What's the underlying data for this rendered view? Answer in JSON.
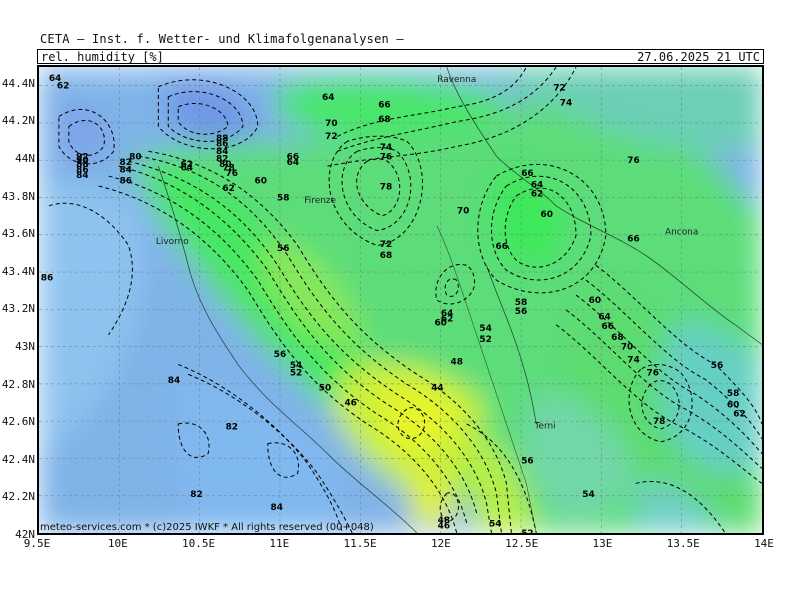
{
  "header": {
    "title": "CETA – Inst. f. Wetter- und Klimafolgenanalysen –",
    "variable": "rel. humidity [%]",
    "datetime": "27.06.2025 21 UTC"
  },
  "footer": "meteo-services.com * (c)2025 IWKF * All rights reserved (00+048)",
  "axes": {
    "y_ticks": [
      "44.4N",
      "44.2N",
      "44N",
      "43.8N",
      "43.6N",
      "43.4N",
      "43.2N",
      "43N",
      "42.8N",
      "42.6N",
      "42.4N",
      "42.2N",
      "42N"
    ],
    "x_ticks": [
      "9.5E",
      "10E",
      "10.5E",
      "11E",
      "11.5E",
      "12E",
      "12.5E",
      "13E",
      "13.5E",
      "14E"
    ],
    "lat_range": [
      42.0,
      44.5
    ],
    "lon_range": [
      9.5,
      14.0
    ],
    "grid": true
  },
  "cities": [
    {
      "name": "Ravenna",
      "lon": 12.1,
      "lat": 44.42
    },
    {
      "name": "Firenze",
      "lon": 11.25,
      "lat": 43.77
    },
    {
      "name": "Livorno",
      "lon": 10.33,
      "lat": 43.55
    },
    {
      "name": "Ancona",
      "lon": 13.5,
      "lat": 43.6
    },
    {
      "name": "Terni",
      "lon": 12.65,
      "lat": 42.56
    }
  ],
  "contour_labels": [
    {
      "text": "64",
      "lon": 9.6,
      "lat": 44.44
    },
    {
      "text": "62",
      "lon": 9.65,
      "lat": 44.4
    },
    {
      "text": "64",
      "lon": 11.3,
      "lat": 44.34
    },
    {
      "text": "66",
      "lon": 11.65,
      "lat": 44.3
    },
    {
      "text": "68",
      "lon": 11.65,
      "lat": 44.22
    },
    {
      "text": "70",
      "lon": 11.32,
      "lat": 44.2
    },
    {
      "text": "72",
      "lon": 11.32,
      "lat": 44.13
    },
    {
      "text": "72",
      "lon": 12.74,
      "lat": 44.39
    },
    {
      "text": "74",
      "lon": 12.78,
      "lat": 44.31
    },
    {
      "text": "74",
      "lon": 11.66,
      "lat": 44.07
    },
    {
      "text": "76",
      "lon": 11.66,
      "lat": 44.02
    },
    {
      "text": "78",
      "lon": 11.66,
      "lat": 43.86
    },
    {
      "text": "76",
      "lon": 13.2,
      "lat": 44.0
    },
    {
      "text": "66",
      "lon": 12.54,
      "lat": 43.93
    },
    {
      "text": "64",
      "lon": 12.6,
      "lat": 43.87
    },
    {
      "text": "62",
      "lon": 12.6,
      "lat": 43.82
    },
    {
      "text": "60",
      "lon": 12.66,
      "lat": 43.71
    },
    {
      "text": "70",
      "lon": 12.14,
      "lat": 43.73
    },
    {
      "text": "66",
      "lon": 12.38,
      "lat": 43.54
    },
    {
      "text": "72",
      "lon": 11.66,
      "lat": 43.55
    },
    {
      "text": "68",
      "lon": 11.66,
      "lat": 43.49
    },
    {
      "text": "66",
      "lon": 13.2,
      "lat": 43.58
    },
    {
      "text": "60",
      "lon": 12.96,
      "lat": 43.25
    },
    {
      "text": "64",
      "lon": 13.02,
      "lat": 43.16
    },
    {
      "text": "66",
      "lon": 13.04,
      "lat": 43.11
    },
    {
      "text": "68",
      "lon": 13.1,
      "lat": 43.05
    },
    {
      "text": "70",
      "lon": 13.16,
      "lat": 43.0
    },
    {
      "text": "74",
      "lon": 13.2,
      "lat": 42.93
    },
    {
      "text": "76",
      "lon": 13.32,
      "lat": 42.86
    },
    {
      "text": "78",
      "lon": 13.36,
      "lat": 42.6
    },
    {
      "text": "56",
      "lon": 13.72,
      "lat": 42.9
    },
    {
      "text": "58",
      "lon": 13.82,
      "lat": 42.75
    },
    {
      "text": "60",
      "lon": 13.82,
      "lat": 42.69
    },
    {
      "text": "62",
      "lon": 13.86,
      "lat": 42.64
    },
    {
      "text": "88",
      "lon": 10.64,
      "lat": 44.12
    },
    {
      "text": "86",
      "lon": 10.64,
      "lat": 44.09
    },
    {
      "text": "84",
      "lon": 10.64,
      "lat": 44.05
    },
    {
      "text": "82",
      "lon": 10.64,
      "lat": 44.01
    },
    {
      "text": "80",
      "lon": 10.66,
      "lat": 43.98
    },
    {
      "text": "78",
      "lon": 10.68,
      "lat": 43.96
    },
    {
      "text": "76",
      "lon": 10.7,
      "lat": 43.93
    },
    {
      "text": "92",
      "lon": 9.77,
      "lat": 44.02
    },
    {
      "text": "90",
      "lon": 9.77,
      "lat": 44.0
    },
    {
      "text": "88",
      "lon": 9.77,
      "lat": 43.98
    },
    {
      "text": "86",
      "lon": 9.77,
      "lat": 43.95
    },
    {
      "text": "84",
      "lon": 9.77,
      "lat": 43.92
    },
    {
      "text": "80",
      "lon": 10.1,
      "lat": 44.02
    },
    {
      "text": "82",
      "lon": 10.04,
      "lat": 43.99
    },
    {
      "text": "84",
      "lon": 10.04,
      "lat": 43.95
    },
    {
      "text": "86",
      "lon": 10.04,
      "lat": 43.89
    },
    {
      "text": "62",
      "lon": 10.42,
      "lat": 43.98
    },
    {
      "text": "64",
      "lon": 10.42,
      "lat": 43.96
    },
    {
      "text": "62",
      "lon": 10.68,
      "lat": 43.85
    },
    {
      "text": "60",
      "lon": 10.88,
      "lat": 43.89
    },
    {
      "text": "66",
      "lon": 11.08,
      "lat": 44.02
    },
    {
      "text": "64",
      "lon": 11.08,
      "lat": 43.99
    },
    {
      "text": "58",
      "lon": 11.02,
      "lat": 43.8
    },
    {
      "text": "56",
      "lon": 11.02,
      "lat": 43.53
    },
    {
      "text": "86",
      "lon": 9.55,
      "lat": 43.37
    },
    {
      "text": "64",
      "lon": 12.04,
      "lat": 43.18
    },
    {
      "text": "62",
      "lon": 12.04,
      "lat": 43.15
    },
    {
      "text": "60",
      "lon": 12.0,
      "lat": 43.13
    },
    {
      "text": "58",
      "lon": 12.5,
      "lat": 43.24
    },
    {
      "text": "56",
      "lon": 12.5,
      "lat": 43.19
    },
    {
      "text": "54",
      "lon": 12.28,
      "lat": 43.1
    },
    {
      "text": "52",
      "lon": 12.28,
      "lat": 43.04
    },
    {
      "text": "56",
      "lon": 11.0,
      "lat": 42.96
    },
    {
      "text": "54",
      "lon": 11.1,
      "lat": 42.9
    },
    {
      "text": "52",
      "lon": 11.1,
      "lat": 42.86
    },
    {
      "text": "50",
      "lon": 11.28,
      "lat": 42.78
    },
    {
      "text": "48",
      "lon": 12.1,
      "lat": 42.92
    },
    {
      "text": "46",
      "lon": 11.44,
      "lat": 42.7
    },
    {
      "text": "44",
      "lon": 11.98,
      "lat": 42.78
    },
    {
      "text": "84",
      "lon": 10.34,
      "lat": 42.82
    },
    {
      "text": "82",
      "lon": 10.7,
      "lat": 42.57
    },
    {
      "text": "82",
      "lon": 10.48,
      "lat": 42.21
    },
    {
      "text": "84",
      "lon": 10.98,
      "lat": 42.14
    },
    {
      "text": "56",
      "lon": 12.54,
      "lat": 42.39
    },
    {
      "text": "54",
      "lon": 12.92,
      "lat": 42.21
    },
    {
      "text": "54",
      "lon": 12.34,
      "lat": 42.05
    },
    {
      "text": "52",
      "lon": 12.54,
      "lat": 42.0
    },
    {
      "text": "48",
      "lon": 12.02,
      "lat": 42.07
    },
    {
      "text": "46",
      "lon": 12.02,
      "lat": 42.04
    }
  ],
  "colors": {
    "blue": "#7fb2ee",
    "light_blue": "#8ec4f0",
    "teal": "#6fd0c8",
    "green": "#5cdf78",
    "bright_green": "#3ee85a",
    "yellow_green": "#bdf03a",
    "yellow": "#e6f22a"
  }
}
